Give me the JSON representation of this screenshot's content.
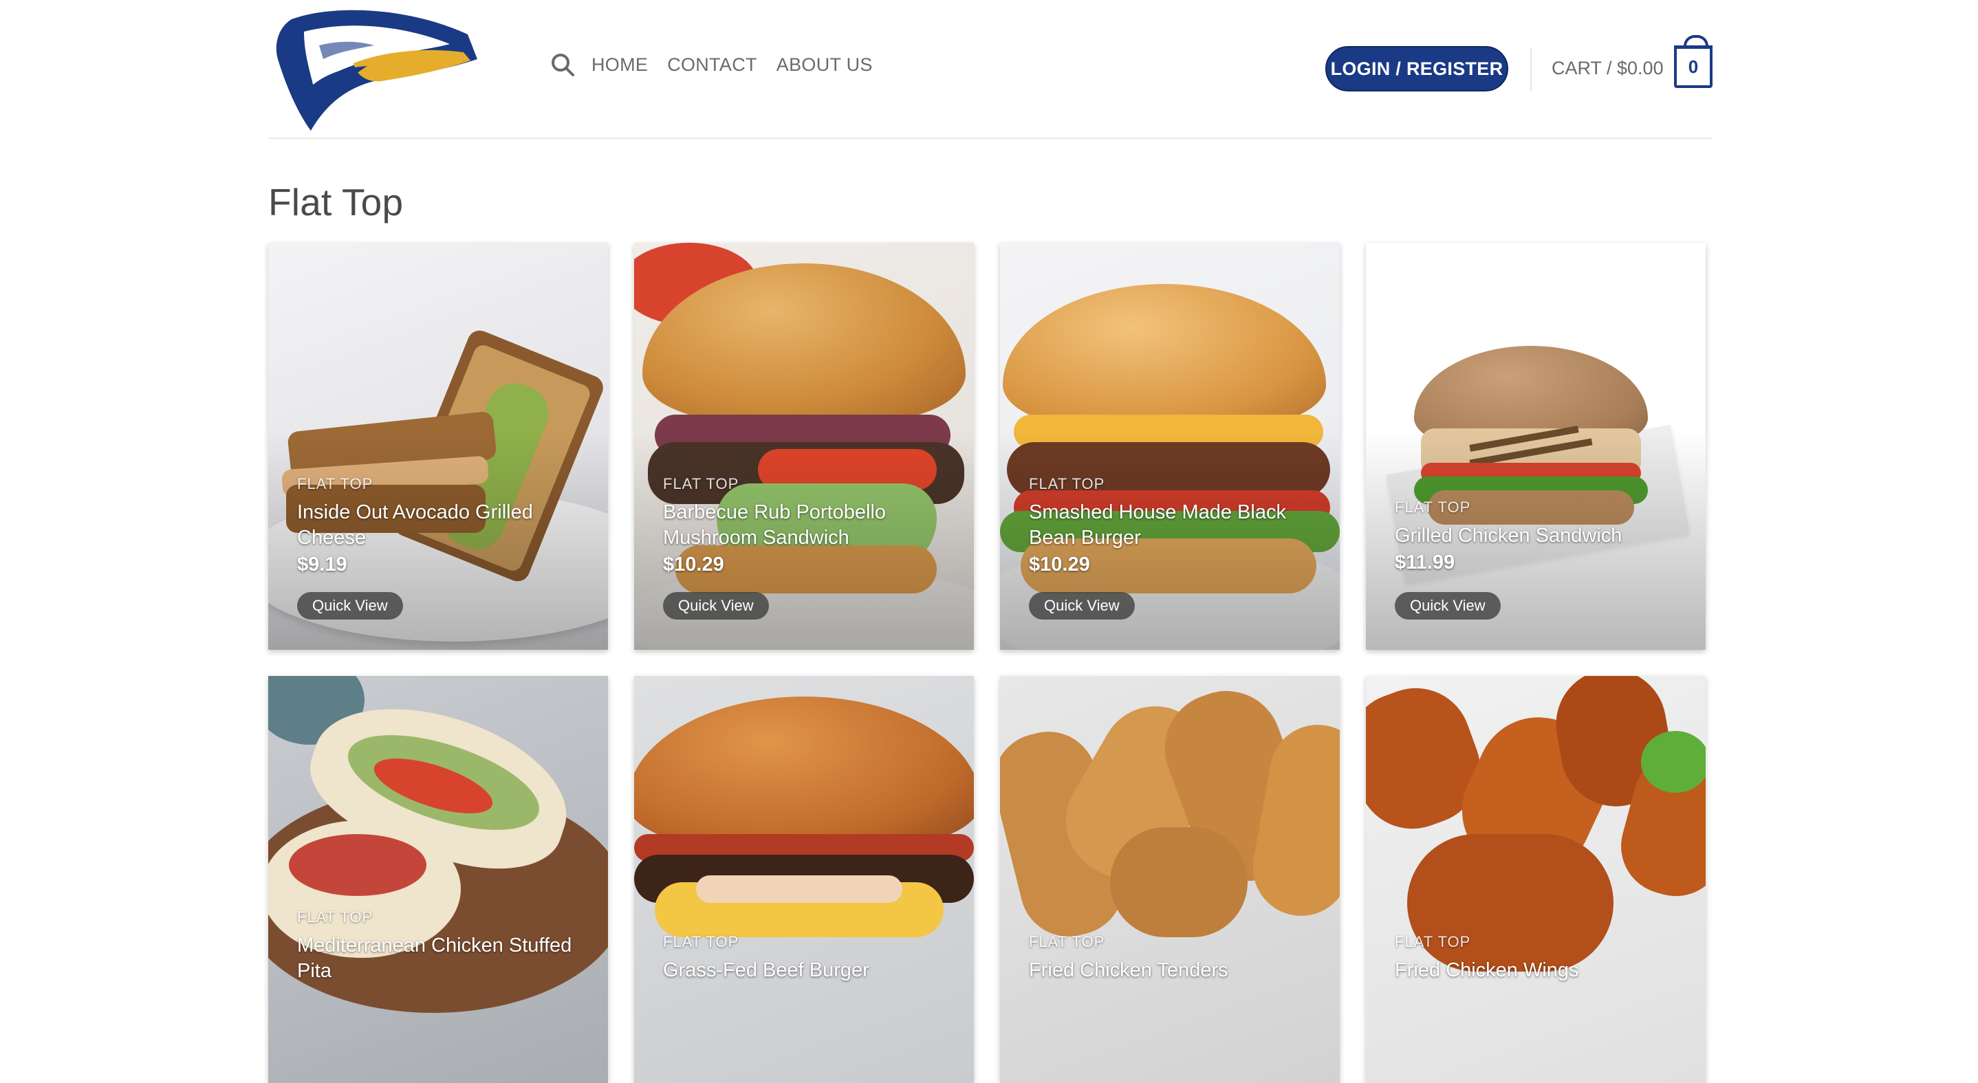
{
  "header": {
    "logo_name": "eagle-logo",
    "nav": [
      {
        "label": "HOME"
      },
      {
        "label": "CONTACT"
      },
      {
        "label": "ABOUT US"
      }
    ],
    "login_label": "LOGIN / REGISTER",
    "cart_label": "CART / $0.00",
    "cart_count": "0"
  },
  "page": {
    "title": "Flat Top"
  },
  "colors": {
    "brand": "#1a3a86",
    "text": "#6a6a6a"
  },
  "products": [
    {
      "category": "FLAT TOP",
      "name": "Inside Out Avocado Grilled Cheese",
      "price": "$9.19",
      "action": "Quick View"
    },
    {
      "category": "FLAT TOP",
      "name": "Barbecue Rub Portobello Mushroom Sandwich",
      "price": "$10.29",
      "action": "Quick View"
    },
    {
      "category": "FLAT TOP",
      "name": "Smashed House Made Black Bean Burger",
      "price": "$10.29",
      "action": "Quick View"
    },
    {
      "category": "FLAT TOP",
      "name": "Grilled Chicken Sandwich",
      "price": "$11.99",
      "action": "Quick View"
    },
    {
      "category": "FLAT TOP",
      "name": "Mediterranean Chicken Stuffed Pita",
      "price": "",
      "action": ""
    },
    {
      "category": "FLAT TOP",
      "name": "Grass-Fed Beef Burger",
      "price": "",
      "action": ""
    },
    {
      "category": "FLAT TOP",
      "name": "Fried Chicken Tenders",
      "price": "",
      "action": ""
    },
    {
      "category": "FLAT TOP",
      "name": "Fried Chicken Wings",
      "price": "",
      "action": ""
    }
  ]
}
